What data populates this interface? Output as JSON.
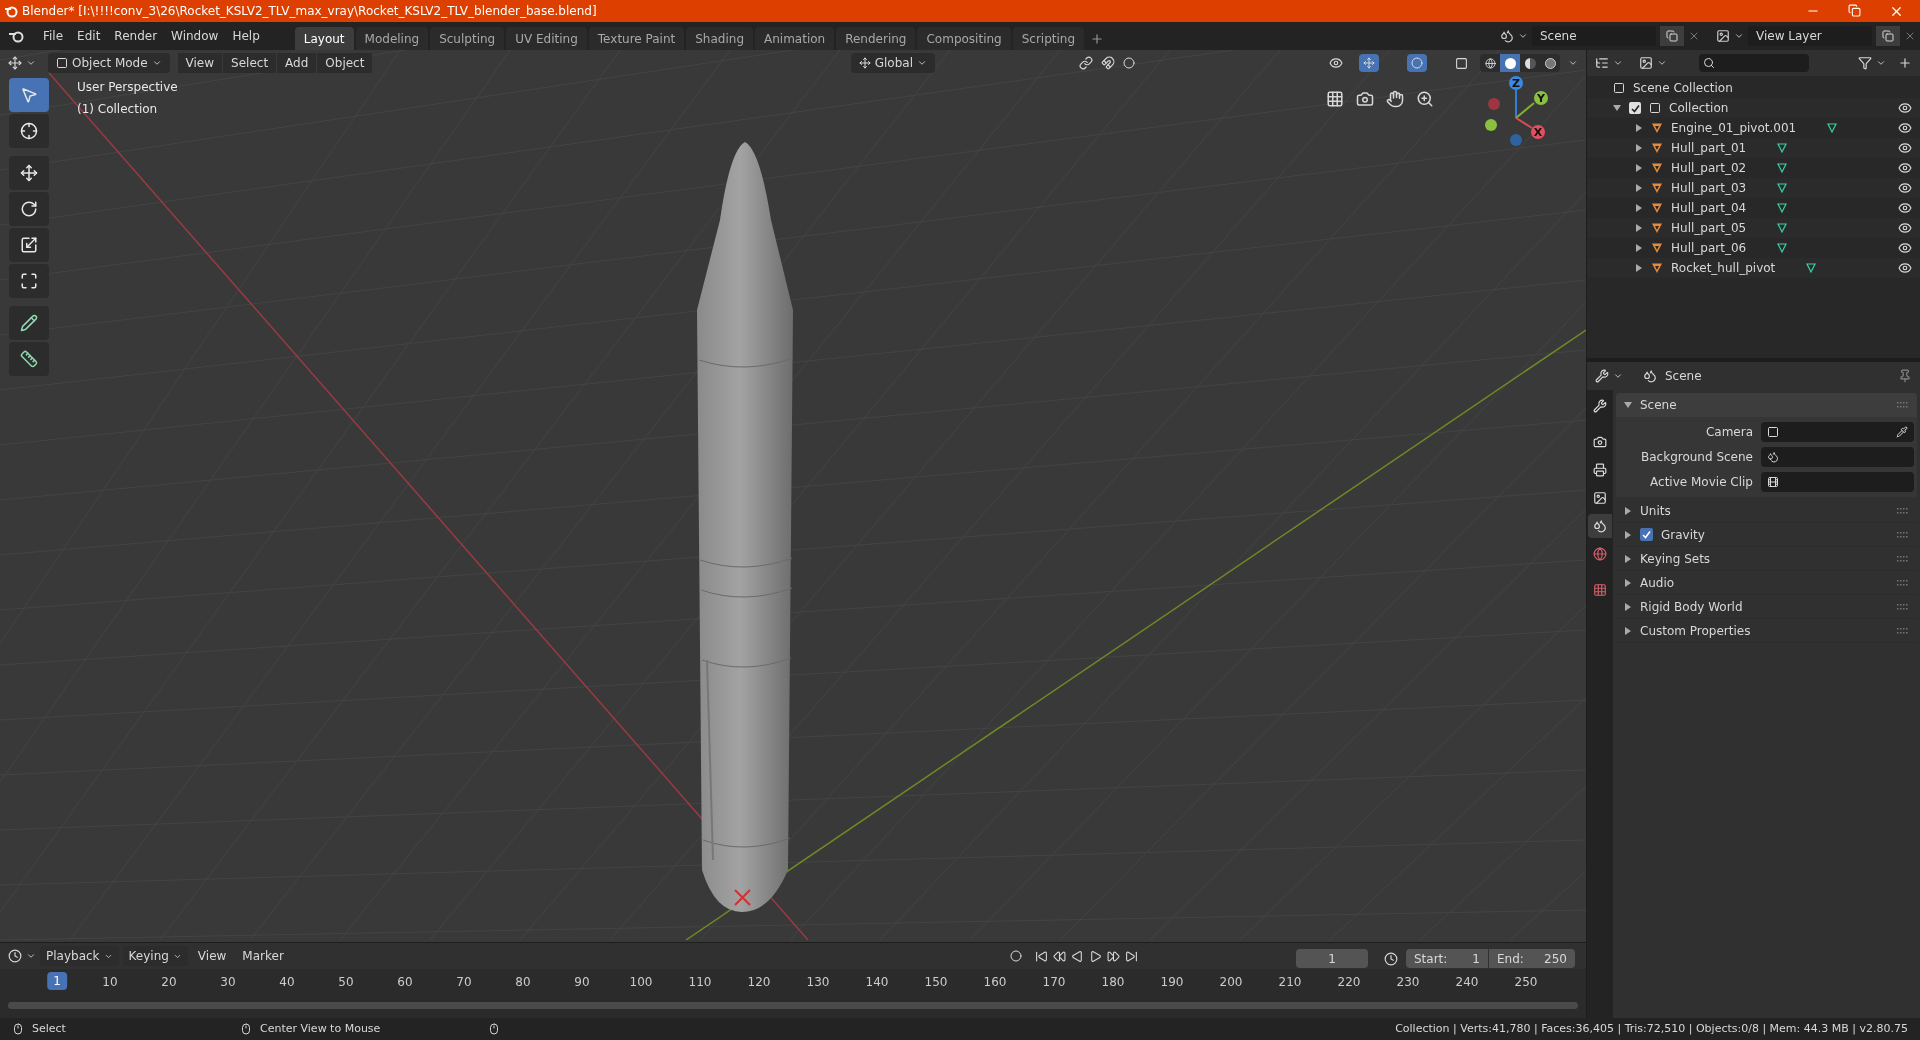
{
  "title_bar": {
    "title": "Blender* [I:\\!!!!conv_3\\26\\Rocket_KSLV2_TLV_max_vray\\Rocket_KSLV2_TLV_blender_base.blend]"
  },
  "menu": [
    "File",
    "Edit",
    "Render",
    "Window",
    "Help"
  ],
  "workspaces": [
    {
      "label": "Layout",
      "selected": true
    },
    {
      "label": "Modeling",
      "selected": false
    },
    {
      "label": "Sculpting",
      "selected": false
    },
    {
      "label": "UV Editing",
      "selected": false
    },
    {
      "label": "Texture Paint",
      "selected": false
    },
    {
      "label": "Shading",
      "selected": false
    },
    {
      "label": "Animation",
      "selected": false
    },
    {
      "label": "Rendering",
      "selected": false
    },
    {
      "label": "Compositing",
      "selected": false
    },
    {
      "label": "Scripting",
      "selected": false
    }
  ],
  "scene_field": "Scene",
  "view_layer_field": "View Layer",
  "viewport_header": {
    "mode": "Object Mode",
    "menus": [
      "View",
      "Select",
      "Add",
      "Object"
    ],
    "orientation": "Global",
    "shading": [
      {
        "kind": "wireframe",
        "selected": false
      },
      {
        "kind": "solid",
        "selected": true
      },
      {
        "kind": "material",
        "selected": false
      },
      {
        "kind": "rendered",
        "selected": false
      }
    ]
  },
  "viewport": {
    "overlay": [
      "User Perspective",
      "(1) Collection"
    ],
    "gizmo": [
      "Z",
      "Y",
      "X"
    ]
  },
  "tools": [
    {
      "kind": "select",
      "selected": true
    },
    {
      "kind": "cursor",
      "selected": false
    },
    {
      "kind": "move",
      "selected": false
    },
    {
      "kind": "rotate",
      "selected": false
    },
    {
      "kind": "scale",
      "selected": false
    },
    {
      "kind": "transform",
      "selected": false
    },
    {
      "kind": "annotate",
      "selected": false
    },
    {
      "kind": "measure",
      "selected": false
    }
  ],
  "outliner": {
    "root": "Scene Collection",
    "collection": {
      "label": "Collection",
      "checked": true,
      "expanded": true,
      "children": [
        {
          "name": "Engine_01_pivot.001"
        },
        {
          "name": "Hull_part_01"
        },
        {
          "name": "Hull_part_02"
        },
        {
          "name": "Hull_part_03"
        },
        {
          "name": "Hull_part_04"
        },
        {
          "name": "Hull_part_05"
        },
        {
          "name": "Hull_part_06"
        },
        {
          "name": "Rocket_hull_pivot"
        }
      ]
    }
  },
  "properties": {
    "header": "Scene",
    "tabs": [
      {
        "kind": "tool",
        "selected": false
      },
      {
        "kind": "render",
        "selected": false
      },
      {
        "kind": "output",
        "selected": false
      },
      {
        "kind": "view_layer",
        "selected": false
      },
      {
        "kind": "scene",
        "selected": true
      },
      {
        "kind": "world",
        "selected": false
      },
      {
        "kind": "texture",
        "selected": false
      }
    ],
    "panel": {
      "label": "Scene",
      "expanded": true,
      "fields": [
        {
          "label": "Camera",
          "kind": "camera"
        },
        {
          "label": "Background Scene",
          "kind": "scene"
        },
        {
          "label": "Active Movie Clip",
          "kind": "clip"
        }
      ]
    },
    "subpanels": [
      {
        "label": "Units"
      },
      {
        "label": "Gravity",
        "checked": true
      },
      {
        "label": "Keying Sets"
      },
      {
        "label": "Audio"
      },
      {
        "label": "Rigid Body World"
      },
      {
        "label": "Custom Properties"
      }
    ]
  },
  "timeline": {
    "menus": [
      "Playback",
      "Keying",
      "View",
      "Marker"
    ],
    "current_frame": "1",
    "start_label": "Start:",
    "start": "1",
    "end_label": "End:",
    "end": "250",
    "ruler": [
      "1",
      "10",
      "20",
      "30",
      "40",
      "50",
      "60",
      "70",
      "80",
      "90",
      "100",
      "110",
      "120",
      "130",
      "140",
      "150",
      "160",
      "170",
      "180",
      "190",
      "200",
      "210",
      "220",
      "230",
      "240",
      "250"
    ]
  },
  "status_bar": {
    "items": [
      "Select",
      "Center View to Mouse"
    ],
    "stats": "Collection | Verts:41,780 | Faces:36,405 | Tris:72,510 | Objects:0/8 | Mem: 44.3 MB | v2.80.75"
  }
}
